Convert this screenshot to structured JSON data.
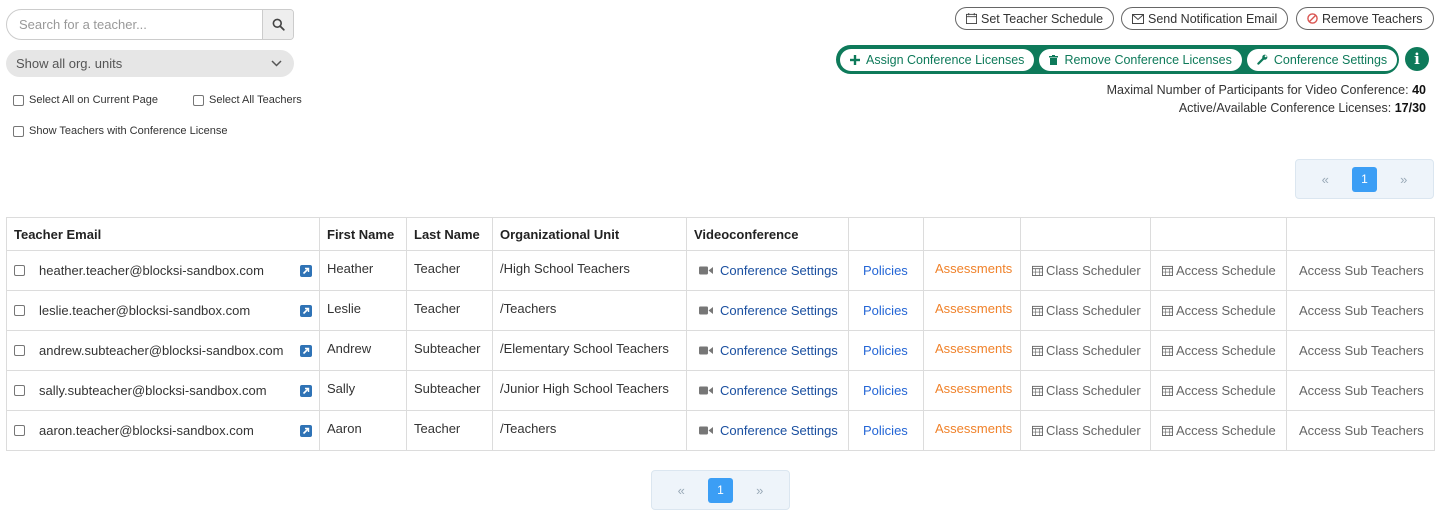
{
  "search": {
    "placeholder": "Search for a teacher...",
    "icon": "search-icon"
  },
  "org_filter": {
    "value": "Show all org. units"
  },
  "checkboxes": {
    "select_page": "Select All on Current Page",
    "select_all": "Select All Teachers",
    "show_licensed": "Show Teachers with Conference License"
  },
  "top_buttons": {
    "set_schedule": "Set Teacher Schedule",
    "send_email": "Send Notification Email",
    "remove_teachers": "Remove Teachers"
  },
  "license_buttons": {
    "assign": "Assign Conference Licenses",
    "remove": "Remove Conference Licenses",
    "settings": "Conference Settings"
  },
  "info_icon": "i",
  "stats": {
    "max_label": "Maximal Number of Participants for Video Conference:",
    "max_value": "40",
    "licenses_label": "Active/Available Conference Licenses:",
    "licenses_value": "17/30"
  },
  "pagination": {
    "prev": "«",
    "page": "1",
    "next": "»"
  },
  "table": {
    "headers": [
      "Teacher Email",
      "First Name",
      "Last Name",
      "Organizational Unit",
      "Videoconference"
    ],
    "rows": [
      {
        "email": "heather.teacher@blocksi-sandbox.com",
        "first": "Heather",
        "last": "Teacher",
        "ou": "/High School Teachers",
        "conf": "Conference Settings",
        "policies": "Policies",
        "assessments": "Assessments",
        "class_sched": "Class Scheduler",
        "access_sched": "Access Schedule",
        "sub": "Access Sub Teachers"
      },
      {
        "email": "leslie.teacher@blocksi-sandbox.com",
        "first": "Leslie",
        "last": "Teacher",
        "ou": "/Teachers",
        "conf": "Conference Settings",
        "policies": "Policies",
        "assessments": "Assessments",
        "class_sched": "Class Scheduler",
        "access_sched": "Access Schedule",
        "sub": "Access Sub Teachers"
      },
      {
        "email": "andrew.subteacher@blocksi-sandbox.com",
        "first": "Andrew",
        "last": "Subteacher",
        "ou": "/Elementary School Teachers",
        "conf": "Conference Settings",
        "policies": "Policies",
        "assessments": "Assessments",
        "class_sched": "Class Scheduler",
        "access_sched": "Access Schedule",
        "sub": "Access Sub Teachers"
      },
      {
        "email": "sally.subteacher@blocksi-sandbox.com",
        "first": "Sally",
        "last": "Subteacher",
        "ou": "/Junior High School Teachers",
        "conf": "Conference Settings",
        "policies": "Policies",
        "assessments": "Assessments",
        "class_sched": "Class Scheduler",
        "access_sched": "Access Schedule",
        "sub": "Access Sub Teachers"
      },
      {
        "email": "aaron.teacher@blocksi-sandbox.com",
        "first": "Aaron",
        "last": "Teacher",
        "ou": "/Teachers",
        "conf": "Conference Settings",
        "policies": "Policies",
        "assessments": "Assessments",
        "class_sched": "Class Scheduler",
        "access_sched": "Access Schedule",
        "sub": "Access Sub Teachers"
      }
    ]
  },
  "colors": {
    "brand_green": "#0e7a5a",
    "page_active": "#3b9ef5",
    "link_blue": "#1a4fa0",
    "assess_orange": "#f0822a",
    "remove_red": "#d9534f"
  }
}
